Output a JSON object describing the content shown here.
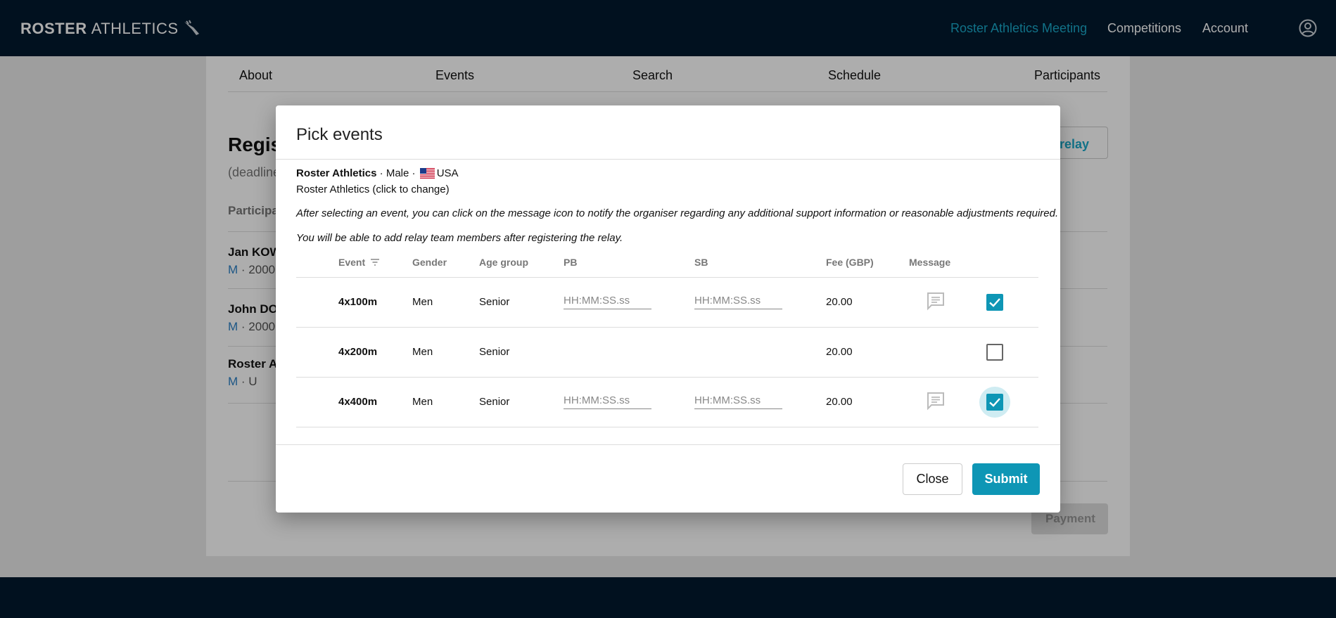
{
  "header": {
    "logo_bold": "ROSTER",
    "logo_light": "ATHLETICS",
    "nav": [
      "Roster Athletics Meeting",
      "Competitions",
      "Account"
    ]
  },
  "bg": {
    "tabs": [
      "About",
      "Events",
      "Search",
      "Schedule",
      "Participants"
    ],
    "title": "Regis",
    "subtitle": "(deadline",
    "header": "Participa",
    "relay_button": "e/relay",
    "participants": [
      {
        "name": "Jan KOW",
        "sex": "M",
        "meta": " · 2000"
      },
      {
        "name": "John DO",
        "sex": "M",
        "meta": " · 2000"
      },
      {
        "name": "Roster A",
        "sex": "M",
        "meta": " · U"
      }
    ],
    "payment_button": "Payment"
  },
  "modal": {
    "title": "Pick events",
    "athlete": "Roster Athletics",
    "sex": "Male",
    "country": "USA",
    "club_line": "Roster Athletics (click to change)",
    "note1": "After selecting an event, you can click on the message icon to notify the organiser regarding any additional support information or reasonable adjustments required.",
    "note2": "You will be able to add relay team members after registering the relay.",
    "columns": {
      "event": "Event",
      "gender": "Gender",
      "age": "Age group",
      "pb": "PB",
      "sb": "SB",
      "fee": "Fee (GBP)",
      "message": "Message"
    },
    "rows": [
      {
        "event": "4x100m",
        "gender": "Men",
        "age": "Senior",
        "pb_placeholder": "HH:MM:SS.ss",
        "sb_placeholder": "HH:MM:SS.ss",
        "fee": "20.00",
        "checked": true
      },
      {
        "event": "4x200m",
        "gender": "Men",
        "age": "Senior",
        "pb_placeholder": "",
        "sb_placeholder": "",
        "fee": "20.00",
        "checked": false
      },
      {
        "event": "4x400m",
        "gender": "Men",
        "age": "Senior",
        "pb_placeholder": "HH:MM:SS.ss",
        "sb_placeholder": "HH:MM:SS.ss",
        "fee": "20.00",
        "checked": true
      }
    ],
    "close_label": "Close",
    "submit_label": "Submit"
  },
  "colors": {
    "navy": "#021a2e",
    "accent": "#0e96b5",
    "link": "#1aa8c9"
  },
  "icons": [
    "runner-shoe-icon",
    "user-circle-icon",
    "sort-icon",
    "message-icon",
    "check-icon",
    "us-flag-icon"
  ]
}
